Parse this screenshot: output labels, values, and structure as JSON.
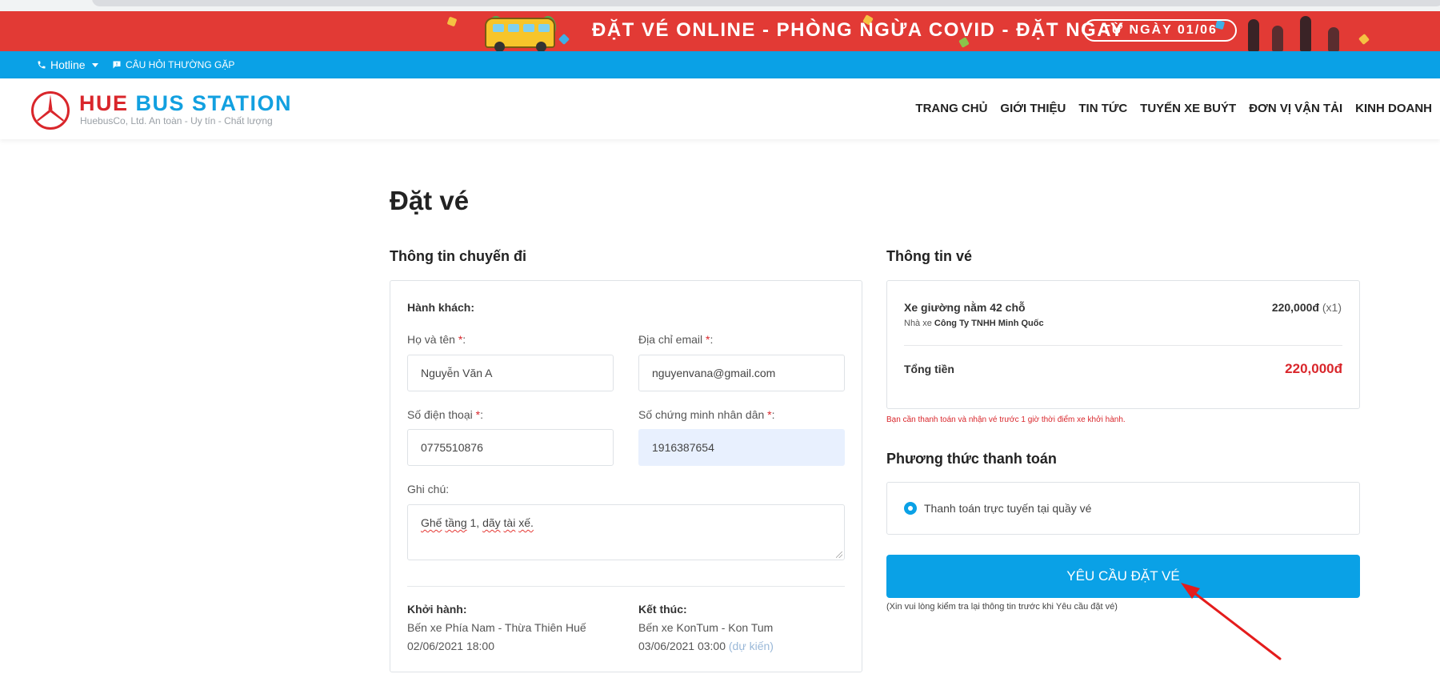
{
  "banner": {
    "text": "ĐẶT VÉ ONLINE - PHÒNG NGỪA COVID - ĐẶT NGAY",
    "date_badge": "TỪ NGÀY 01/06",
    "colors": {
      "background": "#e23a35",
      "text": "#ffffff"
    }
  },
  "topbar": {
    "hotline_label": "Hotline",
    "hotline_icon": "phone-icon",
    "faq_label": "CÂU HỎI THƯỜNG GẶP",
    "faq_icon": "chat-icon",
    "color": "#0aa1e6"
  },
  "header": {
    "logo_word1": "HUE",
    "logo_word2": "BUS STATION",
    "logo_subtitle": "HuebusCo, Ltd. An toàn - Uy tín - Chất lượng",
    "logo_icon": "mercedes-star-icon",
    "nav": [
      "TRANG CHỦ",
      "GIỚI THIỆU",
      "TIN TỨC",
      "TUYẾN XE BUÝT",
      "ĐƠN VỊ VẬN TẢI",
      "KINH DOANH"
    ]
  },
  "page": {
    "title": "Đặt vé"
  },
  "trip": {
    "section_title": "Thông tin chuyến đi",
    "passenger_heading": "Hành khách:",
    "fullname_label": "Họ và tên",
    "fullname_value": "Nguyễn Văn A",
    "email_label": "Địa chỉ email",
    "email_value": "nguyenvana@gmail.com",
    "phone_label": "Số điện thoại",
    "phone_value": "0775510876",
    "id_label": "Số chứng minh nhân dân",
    "id_value": "1916387654",
    "required_mark": "*",
    "label_suffix": ":",
    "note_label": "Ghi chú:",
    "note_value_parts": [
      "Ghế",
      "tầng",
      "1,",
      "dãy",
      "tài",
      "xế."
    ],
    "departure_heading": "Khởi hành:",
    "departure_place": "Bến xe Phía Nam - Thừa Thiên Huế",
    "departure_time": "02/06/2021 18:00",
    "arrival_heading": "Kết thúc:",
    "arrival_place": "Bến xe KonTum - Kon Tum",
    "arrival_time": "03/06/2021 03:00",
    "arrival_estimate": "(dự kiến)"
  },
  "ticket": {
    "section_title": "Thông tin vé",
    "vehicle": "Xe giường nằm 42 chỗ",
    "company_prefix": "Nhà xe",
    "company": "Công Ty TNHH Minh Quốc",
    "price": "220,000đ",
    "quantity": "(x1)",
    "total_label": "Tổng tiền",
    "total_value": "220,000đ",
    "payment_note": "Bạn cần thanh toán và nhận vé trước 1 giờ thời điểm xe khởi hành.",
    "accent_red": "#d9262b"
  },
  "payment": {
    "section_title": "Phương thức thanh toán",
    "option_label": "Thanh toán trực tuyến tại quầy vé",
    "option_selected": true
  },
  "submit": {
    "label": "YÊU CẦU ĐẶT VÉ",
    "note": "(Xin vui lòng kiểm tra lại thông tin trước khi Yêu cầu đặt vé)",
    "color": "#0aa1e6"
  },
  "annotation": {
    "arrow_color": "#e41c1c"
  }
}
